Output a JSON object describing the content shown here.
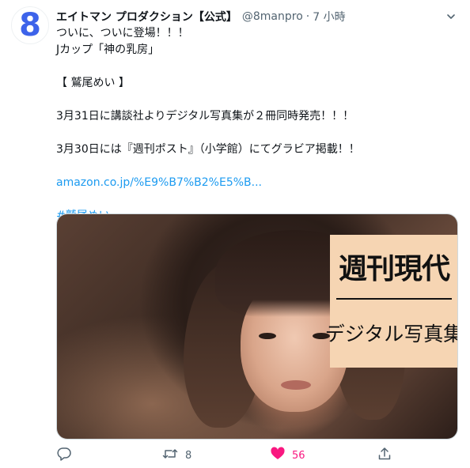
{
  "avatar": {
    "text": "8",
    "color": "#3d63ea"
  },
  "header": {
    "display_name": "エイトマン プロダクション【公式】",
    "handle": "@8manpro",
    "separator": "·",
    "time": "7 小時"
  },
  "body": {
    "line1": "ついに、ついに登場！！！",
    "line2": "Jカップ「神の乳房」",
    "line3": "【 鷲尾めい 】",
    "line4": "3月31日に講談社よりデジタル写真集が２冊同時発売！！！",
    "line5": "3月30日には『週刊ポスト』（小学館）にてグラビア掲載！！",
    "link": "amazon.co.jp/%E9%B7%B2%E5%B...",
    "hashtag": "#鷲尾めい"
  },
  "media": {
    "title": "週刊現代",
    "subtitle": "デジタル写真集"
  },
  "actions": {
    "reply_icon": "reply-icon",
    "retweet_icon": "retweet-icon",
    "retweet_count": "8",
    "like_icon": "heart-icon",
    "like_count": "56",
    "like_color": "#f91880",
    "share_icon": "share-icon"
  },
  "colors": {
    "link": "#1d9bf0",
    "muted": "#536471",
    "text": "#0f1419"
  }
}
